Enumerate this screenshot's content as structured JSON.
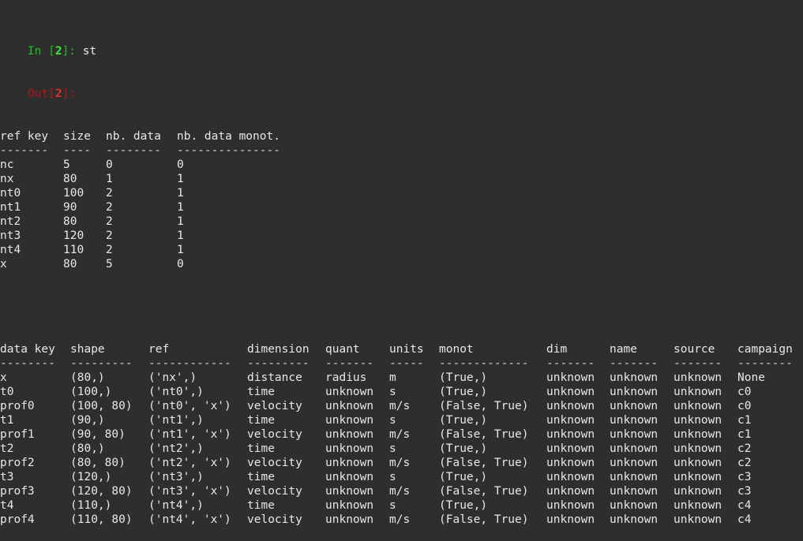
{
  "session": {
    "in_label": "In [",
    "in_num": "2",
    "in_close": "]: ",
    "command": "st",
    "out_label": "Out[",
    "out_num": "2",
    "out_close": "]:"
  },
  "ref_table": {
    "headers": [
      "ref key",
      "size",
      "nb. data",
      "nb. data monot."
    ],
    "dashes": [
      "-------",
      "----",
      "--------",
      "---------------"
    ],
    "rows": [
      [
        "nc",
        "5",
        "0",
        "0"
      ],
      [
        "nx",
        "80",
        "1",
        "1"
      ],
      [
        "nt0",
        "100",
        "2",
        "1"
      ],
      [
        "nt1",
        "90",
        "2",
        "1"
      ],
      [
        "nt2",
        "80",
        "2",
        "1"
      ],
      [
        "nt3",
        "120",
        "2",
        "1"
      ],
      [
        "nt4",
        "110",
        "2",
        "1"
      ],
      [
        "x",
        "80",
        "5",
        "0"
      ]
    ]
  },
  "data_table": {
    "headers": [
      "data key",
      "shape",
      "ref",
      "dimension",
      "quant",
      "units",
      "monot",
      "dim",
      "name",
      "source",
      "campaign"
    ],
    "dashes": [
      "--------",
      "---------",
      "------------",
      "---------",
      "-------",
      "-----",
      "-------------",
      "-------",
      "-------",
      "-------",
      "--------"
    ],
    "rows": [
      [
        "x",
        "(80,)",
        "('nx',)",
        "distance",
        "radius",
        "m",
        "(True,)",
        "unknown",
        "unknown",
        "unknown",
        "None"
      ],
      [
        "t0",
        "(100,)",
        "('nt0',)",
        "time",
        "unknown",
        "s",
        "(True,)",
        "unknown",
        "unknown",
        "unknown",
        "c0"
      ],
      [
        "prof0",
        "(100, 80)",
        "('nt0', 'x')",
        "velocity",
        "unknown",
        "m/s",
        "(False, True)",
        "unknown",
        "unknown",
        "unknown",
        "c0"
      ],
      [
        "t1",
        "(90,)",
        "('nt1',)",
        "time",
        "unknown",
        "s",
        "(True,)",
        "unknown",
        "unknown",
        "unknown",
        "c1"
      ],
      [
        "prof1",
        "(90, 80)",
        "('nt1', 'x')",
        "velocity",
        "unknown",
        "m/s",
        "(False, True)",
        "unknown",
        "unknown",
        "unknown",
        "c1"
      ],
      [
        "t2",
        "(80,)",
        "('nt2',)",
        "time",
        "unknown",
        "s",
        "(True,)",
        "unknown",
        "unknown",
        "unknown",
        "c2"
      ],
      [
        "prof2",
        "(80, 80)",
        "('nt2', 'x')",
        "velocity",
        "unknown",
        "m/s",
        "(False, True)",
        "unknown",
        "unknown",
        "unknown",
        "c2"
      ],
      [
        "t3",
        "(120,)",
        "('nt3',)",
        "time",
        "unknown",
        "s",
        "(True,)",
        "unknown",
        "unknown",
        "unknown",
        "c3"
      ],
      [
        "prof3",
        "(120, 80)",
        "('nt3', 'x')",
        "velocity",
        "unknown",
        "m/s",
        "(False, True)",
        "unknown",
        "unknown",
        "unknown",
        "c3"
      ],
      [
        "t4",
        "(110,)",
        "('nt4',)",
        "time",
        "unknown",
        "s",
        "(True,)",
        "unknown",
        "unknown",
        "unknown",
        "c4"
      ],
      [
        "prof4",
        "(110, 80)",
        "('nt4', 'x')",
        "velocity",
        "unknown",
        "m/s",
        "(False, True)",
        "unknown",
        "unknown",
        "unknown",
        "c4"
      ]
    ]
  }
}
